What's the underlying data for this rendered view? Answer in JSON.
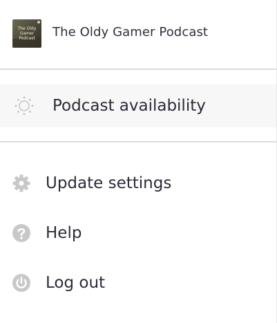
{
  "header": {
    "title": "The Oldy Gamer Podcast",
    "artwork_text": "The Oldy Gamer Podcast"
  },
  "availability": {
    "label": "Podcast availability",
    "icon": "sun-status-icon"
  },
  "menu": {
    "items": [
      {
        "label": "Update settings",
        "icon": "gear-icon"
      },
      {
        "label": "Help",
        "icon": "question-circle-icon"
      },
      {
        "label": "Log out",
        "icon": "power-icon"
      }
    ]
  },
  "colors": {
    "text": "#2b2b38",
    "icon_gray": "#c8c8c8",
    "highlight_bg": "#f7f7f7",
    "divider": "#dcdcdc"
  }
}
